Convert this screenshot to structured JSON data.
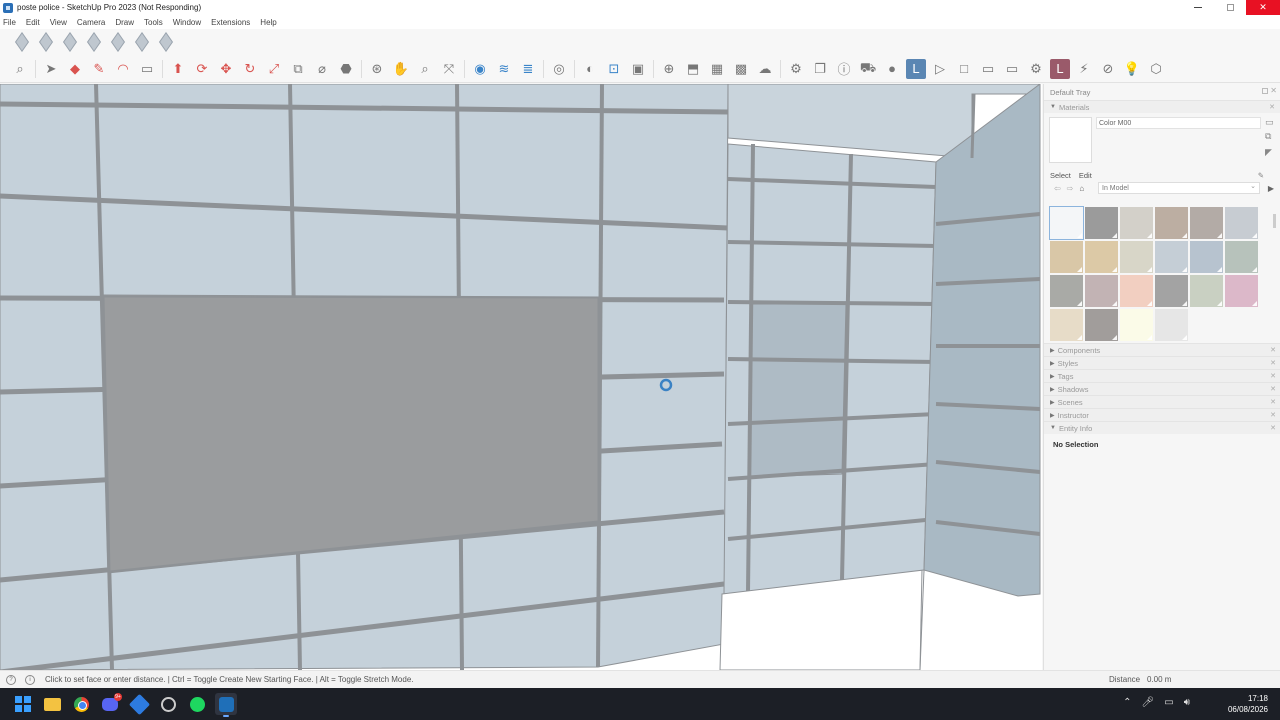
{
  "window": {
    "title": "poste police - SketchUp Pro 2023 (Not Responding)",
    "controls": {
      "minimize": "─",
      "maximize": "□",
      "close": "✕"
    }
  },
  "menu": [
    "File",
    "Edit",
    "View",
    "Camera",
    "Draw",
    "Tools",
    "Window",
    "Extensions",
    "Help"
  ],
  "tray": {
    "title": "Default Tray",
    "materials": {
      "header": "Materials",
      "current_name": "Color M00",
      "tab_select": "Select",
      "tab_edit": "Edit",
      "collection": "In Model",
      "swatch_colors": [
        "#f4f6f8",
        "#9b9b9b",
        "#d3d0c9",
        "#bcaea2",
        "#b3aba6",
        "#c7ccd2",
        "#d9c7a7",
        "#dcc9a6",
        "#d8d6c8",
        "#c5ced6",
        "#b7c3cf",
        "#b7c2bb",
        "#a9aaa6",
        "#c2b3b4",
        "#f2cfc1",
        "#a3a3a3",
        "#c9d0c2",
        "#dcb8c9",
        "#e7dcc8",
        "#a19d9b",
        "#fbfbe8",
        "#e6e6e6"
      ]
    },
    "sections": [
      "Components",
      "Styles",
      "Tags",
      "Shadows",
      "Scenes",
      "Instructor",
      "Entity Info"
    ],
    "entity_info_text": "No Selection"
  },
  "status": {
    "hint": "Click to set face or enter distance. | Ctrl = Toggle Create New Starting Face. | Alt = Toggle Stretch Mode.",
    "distance_label": "Distance",
    "distance_value": "0.00 m"
  },
  "taskbar": {
    "discord_badge": "9+",
    "time": "17:18",
    "date": "06/08/2026"
  },
  "colors": {
    "tile": "#c5d1da",
    "tile_dark": "#9a9c9e",
    "grout": "#8e9296",
    "accent": "#5a86b3"
  }
}
